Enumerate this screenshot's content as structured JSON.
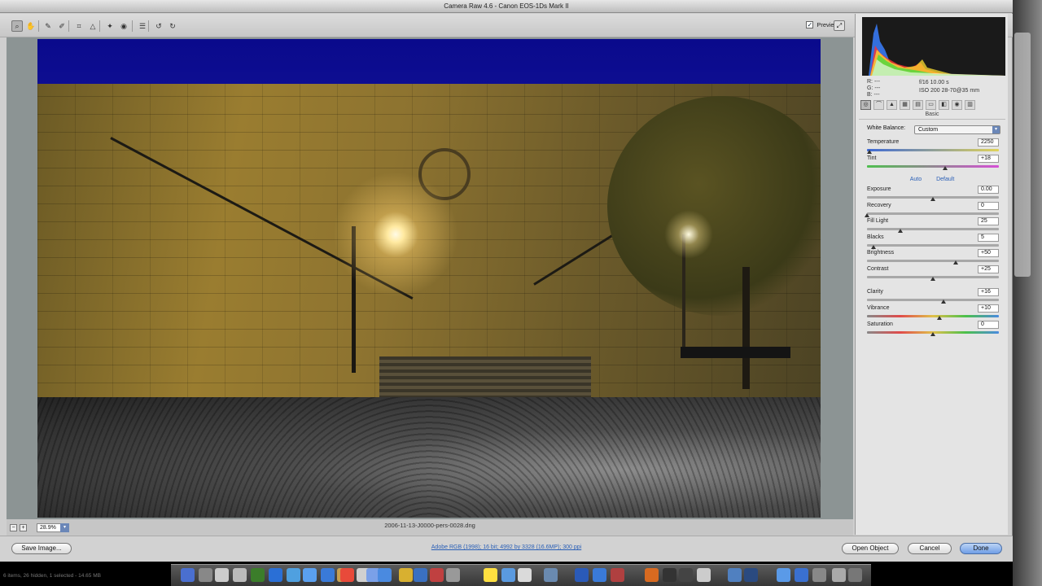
{
  "window": {
    "title": "Camera Raw 4.6  -  Canon EOS-1Ds Mark II"
  },
  "toolbar": {
    "tools": [
      {
        "icon": "zoom-icon",
        "glyph": "⌕"
      },
      {
        "icon": "hand-icon",
        "glyph": "✋"
      },
      {
        "icon": "white-balance-icon",
        "glyph": "✎"
      },
      {
        "icon": "color-sampler-icon",
        "glyph": "✐"
      },
      {
        "icon": "crop-icon",
        "glyph": "⌗"
      },
      {
        "icon": "straighten-icon",
        "glyph": "△"
      },
      {
        "icon": "retouch-icon",
        "glyph": "✦"
      },
      {
        "icon": "red-eye-icon",
        "glyph": "◉"
      },
      {
        "icon": "preferences-icon",
        "glyph": "☰"
      },
      {
        "icon": "rotate-left-icon",
        "glyph": "↺"
      },
      {
        "icon": "rotate-right-icon",
        "glyph": "↻"
      }
    ],
    "preview_label": "Preview",
    "preview_checked": "✓"
  },
  "image": {
    "zoom_value": "28.9%",
    "filename": "2006-11-13-J0000-pers-0028.dng"
  },
  "panel": {
    "info": {
      "r": "R:  ---",
      "g": "G:  ---",
      "b": "B:  ---",
      "aperture_shutter": "f/16   10.00 s",
      "iso_lens": "ISO 200    28-70@35 mm"
    },
    "section_title": "Basic",
    "white_balance": {
      "label": "White Balance:",
      "value": "Custom"
    },
    "auto_label": "Auto",
    "default_label": "Default",
    "sliders": [
      {
        "name": "temperature",
        "label": "Temperature",
        "value": "2250",
        "position": 0.02,
        "track": "temp"
      },
      {
        "name": "tint",
        "label": "Tint",
        "value": "+18",
        "position": 0.59,
        "track": "tint"
      },
      {
        "name": "exposure",
        "label": "Exposure",
        "value": "0.00",
        "position": 0.5,
        "track": "plain"
      },
      {
        "name": "recovery",
        "label": "Recovery",
        "value": "0",
        "position": 0.0,
        "track": "plain"
      },
      {
        "name": "fill-light",
        "label": "Fill Light",
        "value": "25",
        "position": 0.25,
        "track": "plain"
      },
      {
        "name": "blacks",
        "label": "Blacks",
        "value": "5",
        "position": 0.05,
        "track": "plain"
      },
      {
        "name": "brightness",
        "label": "Brightness",
        "value": "+50",
        "position": 0.67,
        "track": "plain"
      },
      {
        "name": "contrast",
        "label": "Contrast",
        "value": "+25",
        "position": 0.5,
        "track": "plain"
      },
      {
        "name": "clarity",
        "label": "Clarity",
        "value": "+16",
        "position": 0.58,
        "track": "plain"
      },
      {
        "name": "vibrance",
        "label": "Vibrance",
        "value": "+10",
        "position": 0.55,
        "track": "sat"
      },
      {
        "name": "saturation",
        "label": "Saturation",
        "value": "0",
        "position": 0.5,
        "track": "sat"
      }
    ]
  },
  "bottom": {
    "save_label": "Save Image...",
    "workflow": "Adobe RGB (1998); 16 bit; 4992 by 3328 (16.6MP); 300 ppi",
    "open_label": "Open Object",
    "cancel_label": "Cancel",
    "done_label": "Done"
  },
  "status": "6 items, 26 hidden, 1 selected - 14.65 MB",
  "colors": {
    "accent": "#6b87b8",
    "link": "#2a5fb6"
  }
}
